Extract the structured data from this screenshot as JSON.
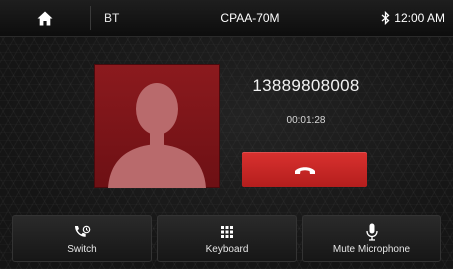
{
  "topbar": {
    "section_label": "BT",
    "device_name": "CPAA-70M",
    "time": "12:00 AM"
  },
  "call": {
    "phone_number": "13889808008",
    "duration": "00:01:28"
  },
  "actions": {
    "switch_label": "Switch",
    "keyboard_label": "Keyboard",
    "mute_label": "Mute Microphone"
  },
  "icons": {
    "home": "home-icon",
    "bluetooth": "bluetooth-icon",
    "avatar": "person-silhouette-icon",
    "hangup": "phone-hangup-icon",
    "switch": "phone-switch-icon",
    "keyboard": "keypad-icon",
    "mute": "microphone-icon"
  },
  "colors": {
    "hangup": "#c82624",
    "avatar_bg": "#7d1519"
  }
}
